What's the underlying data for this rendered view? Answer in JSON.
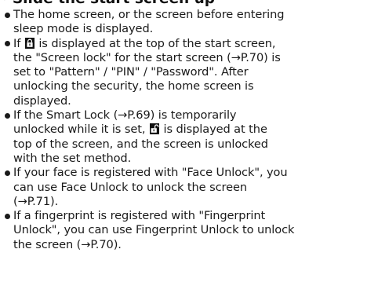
{
  "heading": {
    "text": "Slide the start screen up"
  },
  "items": [
    {
      "lines": [
        "The home screen, or the screen before entering",
        "sleep mode is displayed."
      ]
    },
    {
      "line1_before_icon": "If",
      "line1_after_icon": "is displayed at the top of the start screen,",
      "icon": "padlock-closed-icon",
      "lines_rest": [
        "the \"Screen lock\" for the start screen (→P.70) is",
        "set to \"Pattern\" / \"PIN\" / \"Password\". After",
        "unlocking the security, the home screen is",
        "displayed."
      ]
    },
    {
      "lines_before_icon": [
        "If the Smart Lock (→P.69) is temporarily"
      ],
      "line_with_icon_before": "unlocked while it is set,",
      "line_with_icon_after": "is displayed at the",
      "icon": "padlock-open-icon",
      "lines_after_icon": [
        "top of the screen, and the screen is unlocked",
        "with the set method."
      ]
    },
    {
      "lines": [
        "If your face is registered with \"Face Unlock\", you",
        "can use Face Unlock to unlock the screen",
        "(→P.71)."
      ]
    },
    {
      "lines": [
        "If a fingerprint is registered with \"Fingerprint",
        "Unlock\", you can use Fingerprint Unlock to unlock",
        "the screen (→P.70)."
      ]
    }
  ]
}
